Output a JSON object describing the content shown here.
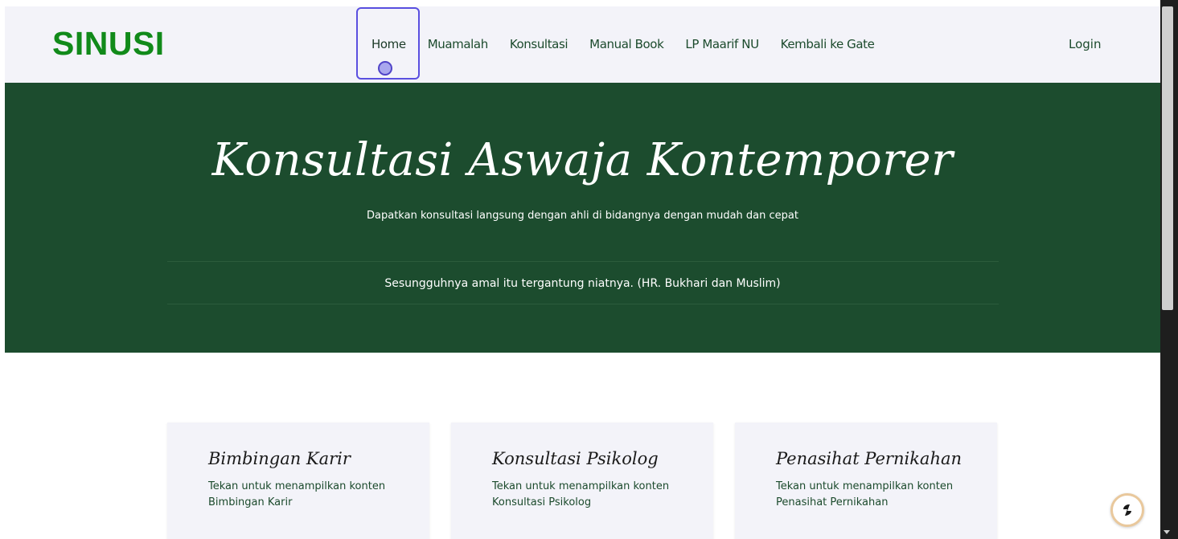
{
  "brand": "SINUSI",
  "nav": {
    "items": [
      {
        "label": "Home"
      },
      {
        "label": "Muamalah"
      },
      {
        "label": "Konsultasi"
      },
      {
        "label": "Manual Book"
      },
      {
        "label": "LP Maarif NU"
      },
      {
        "label": "Kembali ke Gate"
      }
    ],
    "login": "Login"
  },
  "hero": {
    "title": "Konsultasi Aswaja Kontemporer",
    "subtitle": "Dapatkan konsultasi langsung dengan ahli di bidangnya dengan mudah dan cepat",
    "quote": "Sesungguhnya amal itu tergantung niatnya. (HR. Bukhari dan Muslim)"
  },
  "cards": [
    {
      "title": "Bimbingan Karir",
      "text": "Tekan untuk menampilkan konten Bimbingan Karir"
    },
    {
      "title": "Konsultasi Psikolog",
      "text": "Tekan untuk menampilkan konten Konsultasi Psikolog"
    },
    {
      "title": "Penasihat Pernikahan",
      "text": "Tekan untuk menampilkan konten Penasihat Pernikahan"
    }
  ],
  "colors": {
    "brand": "#118a1a",
    "hero_bg": "#1c4c2e",
    "nav_bg": "#f3f3f9",
    "focus": "#5a4fe0"
  },
  "icons": {
    "chat": "chat-widget-icon"
  }
}
